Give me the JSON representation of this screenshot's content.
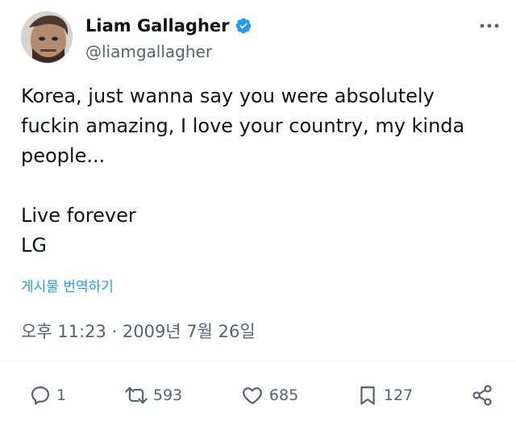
{
  "user": {
    "display_name": "Liam Gallagher",
    "handle": "@liamgallagher",
    "verified_icon": "verified-badge-icon",
    "accent_color": "#1d9bf0"
  },
  "tweet": {
    "text": "Korea, just wanna say you were absolutely\nfuckin amazing, I love your country, my kinda\npeople...\n\nLive forever\nLG",
    "translate_label": "게시물 번역하기",
    "timestamp": "오후 11:23 · 2009년 7월 26일"
  },
  "actions": {
    "reply": {
      "icon": "reply-icon",
      "count": "1"
    },
    "repost": {
      "icon": "repost-icon",
      "count": "593"
    },
    "like": {
      "icon": "heart-icon",
      "count": "685"
    },
    "bookmark": {
      "icon": "bookmark-icon",
      "count": "127"
    },
    "share": {
      "icon": "share-icon"
    }
  },
  "colors": {
    "text": "#0f1419",
    "secondary": "#536471",
    "link": "#1d9bf0"
  }
}
